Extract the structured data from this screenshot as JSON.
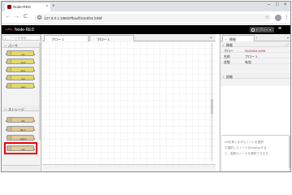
{
  "browser": {
    "tab_title": "Node-RED",
    "tab_close": "×",
    "new_tab": "+",
    "url": "127.0.0.1:1880/#flow/f3c54f34.fc99f",
    "window_controls": [
      "–",
      "□",
      "×"
    ],
    "nav": {
      "back": "←",
      "forward": "→",
      "reload": "C"
    },
    "menu": "⋮"
  },
  "header": {
    "title": "Node-RED",
    "deploy_label": "デプロイ ▾",
    "menu_icon": "≡"
  },
  "palette": {
    "filter_placeholder": "ノードを検索",
    "categories": [
      {
        "label": "パーサ"
      },
      {
        "label": "ストレージ"
      }
    ],
    "parser_nodes": [
      "csv",
      "html",
      "json",
      "xml",
      "yaml"
    ],
    "storage_nodes": [
      "file",
      "file in",
      "watch",
      "tail"
    ]
  },
  "workspace": {
    "tabs": [
      {
        "label": "フロー 1"
      },
      {
        "label": "フロー 1"
      }
    ],
    "add_tab": "+"
  },
  "sidebar": {
    "active_tab": "情報",
    "second_tab": "i",
    "section_info": "情報",
    "rows": [
      {
        "key": "フロー",
        "value": "f3c54f34.fc99f"
      },
      {
        "key": "名前",
        "value": "フロー 1"
      },
      {
        "key": "状態",
        "value": "有効"
      }
    ],
    "section_detail": "詳細",
    "tip_lines": [
      "ctrlを押しながらノードを選択",
      "⌘選択したノードをsubflowする",
      "と、複数のノードを選択できます。"
    ]
  },
  "colors": {
    "header_bg": "#000000",
    "parser_node": "#e2d96e",
    "storage_node": "#e0c898",
    "highlight": "#ee0000"
  }
}
